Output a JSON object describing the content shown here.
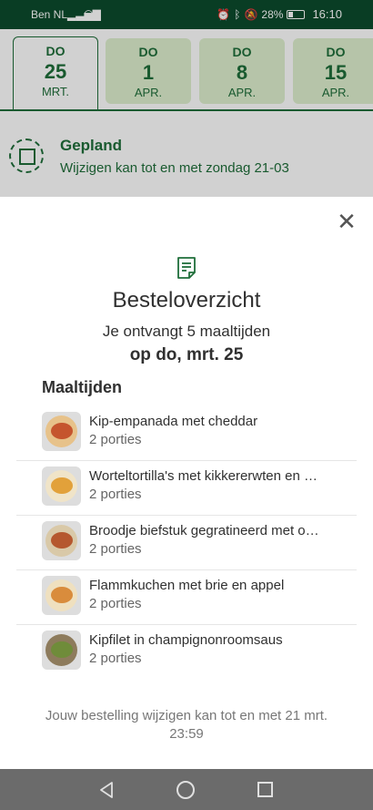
{
  "statusbar": {
    "carrier": "Ben NL",
    "battery": "28%",
    "time": "16:10"
  },
  "date_tabs": [
    {
      "dow": "DO",
      "day": "25",
      "month": "MRT.",
      "active": true
    },
    {
      "dow": "DO",
      "day": "1",
      "month": "APR.",
      "active": false
    },
    {
      "dow": "DO",
      "day": "8",
      "month": "APR.",
      "active": false
    },
    {
      "dow": "DO",
      "day": "15",
      "month": "APR.",
      "active": false
    }
  ],
  "planned": {
    "title": "Gepland",
    "subtitle": "Wijzigen kan tot en met zondag 21-03"
  },
  "modal": {
    "title": "Besteloverzicht",
    "receive_text": "Je ontvangt 5 maaltijden",
    "delivery_date": "op do, mrt. 25",
    "section_title": "Maaltijden",
    "meals": [
      {
        "name": "Kip-empanada met cheddar",
        "portions": "2 porties",
        "plate_color": "#e7c28a",
        "food_color": "#c5552e"
      },
      {
        "name": "Worteltortilla's met kikkererwten en …",
        "portions": "2 porties",
        "plate_color": "#f0e4c8",
        "food_color": "#e2a13a"
      },
      {
        "name": "Broodje biefstuk gegratineerd met o…",
        "portions": "2 porties",
        "plate_color": "#d9c9a8",
        "food_color": "#b5582f"
      },
      {
        "name": "Flammkuchen met brie en appel",
        "portions": "2 porties",
        "plate_color": "#efe0bf",
        "food_color": "#d98c3c"
      },
      {
        "name": "Kipfilet in champignonroomsaus",
        "portions": "2 porties",
        "plate_color": "#8d7b5c",
        "food_color": "#6f8c3a"
      }
    ],
    "footer_note": "Jouw bestelling wijzigen kan tot en met 21 mrt. 23:59"
  },
  "colors": {
    "brand_green": "#1f6e3a",
    "statusbar_bg": "#0b4b2c",
    "inactive_tab_bg": "#dfefcf"
  }
}
